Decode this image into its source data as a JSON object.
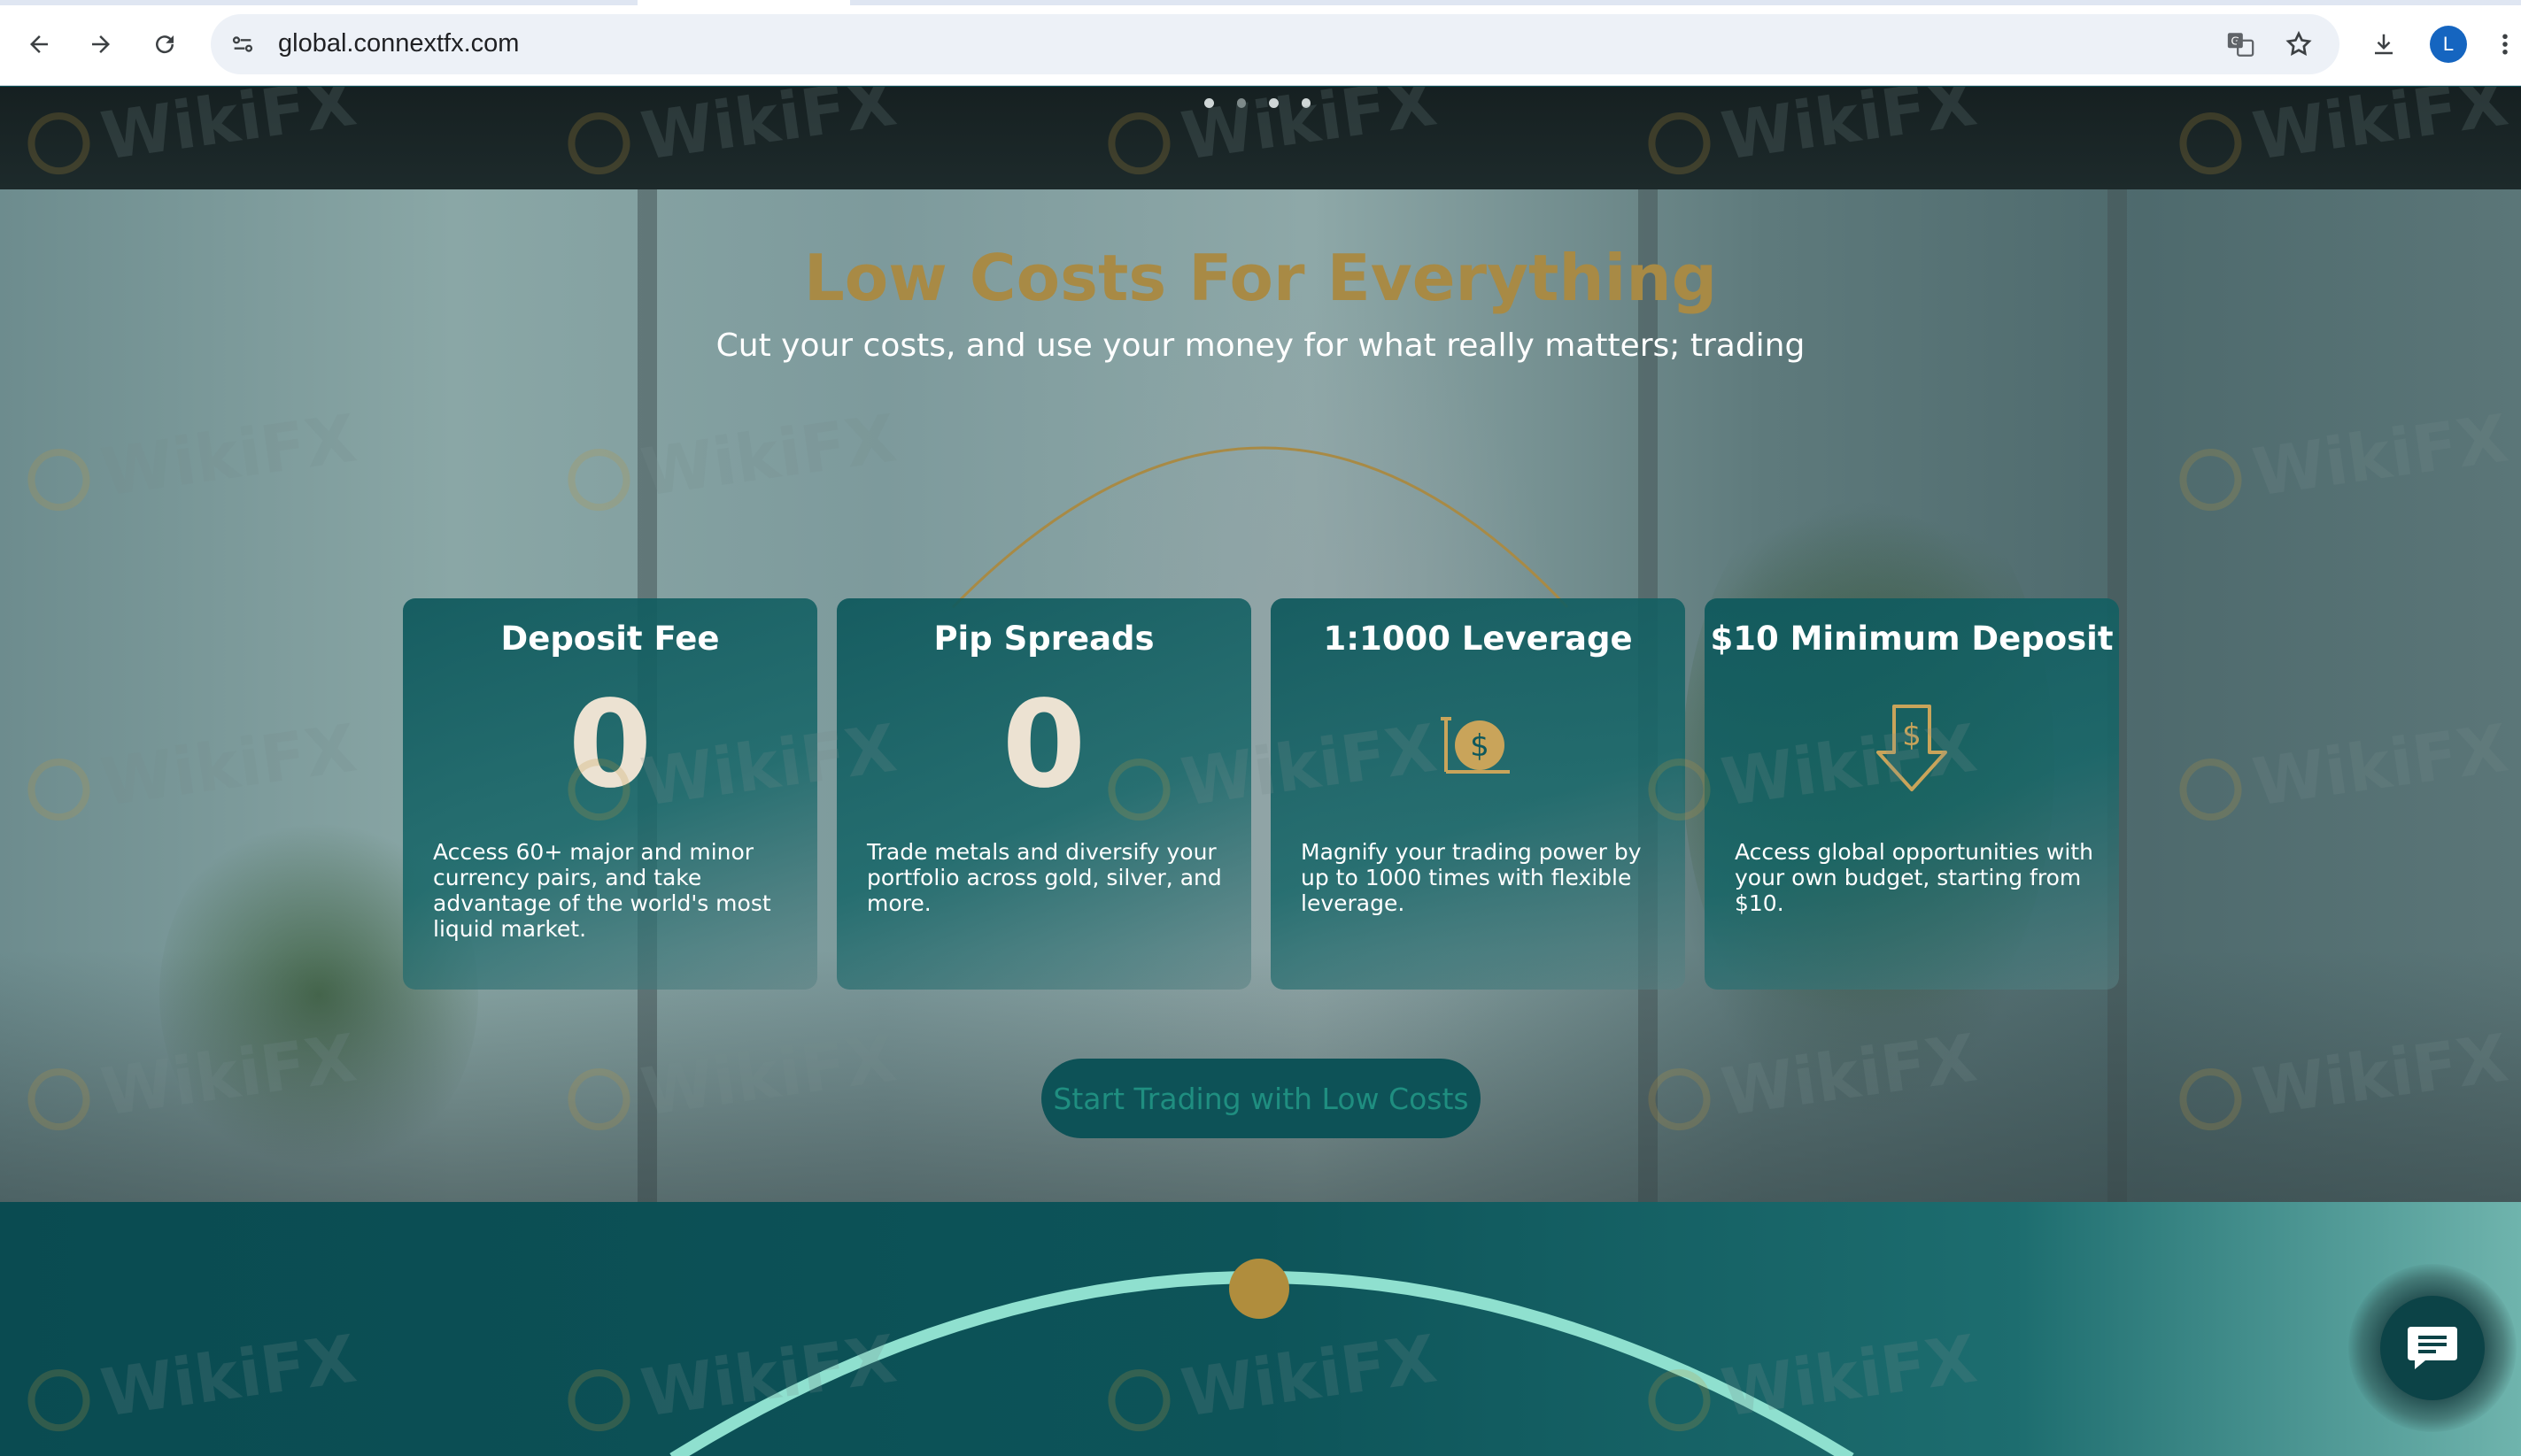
{
  "browser": {
    "url": "global.connextfx.com",
    "profile_initial": "L",
    "icons": [
      "back-arrow-icon",
      "forward-arrow-icon",
      "reload-icon",
      "site-info-icon",
      "translate-icon",
      "bookmark-star-icon",
      "download-icon",
      "menu-dots-icon"
    ]
  },
  "carousel": {
    "dot_count": 4
  },
  "costs": {
    "title": "Low Costs For Everything",
    "subtitle": "Cut your costs, and use your money for what really matters; trading",
    "cards": [
      {
        "title": "Deposit Fee",
        "value": "0",
        "description": "Access 60+ major and minor currency pairs, and take advantage of the world's most liquid market."
      },
      {
        "title": "Pip Spreads",
        "value": "0",
        "description": "Trade metals and diversify your portfolio across gold, silver, and more."
      },
      {
        "title": "1:1000 Leverage",
        "icon": "dollar-leverage-icon",
        "description": "Magnify your trading power by up to 1000 times with flexible leverage."
      },
      {
        "title": "$10 Minimum Deposit",
        "icon": "dollar-down-arrow-icon",
        "description": "Access global opportunities with your own budget, starting from $10."
      }
    ],
    "cta_label": "Start Trading with Low Costs"
  },
  "watermark": {
    "text": "WikiFX"
  },
  "colors": {
    "accent_gold": "#a88a45",
    "card_teal": "#0e585c",
    "bottom_teal": "#0a4b51",
    "arc_mint": "#8fe0cf"
  }
}
